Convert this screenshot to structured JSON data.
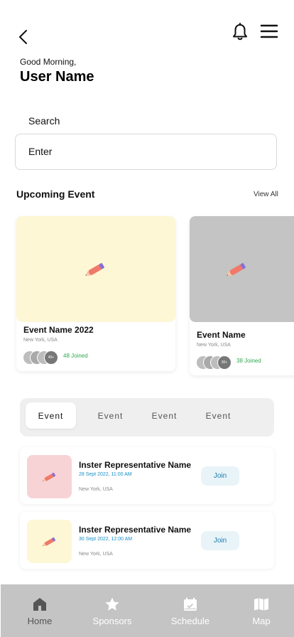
{
  "header": {
    "greeting": "Good Morning,",
    "user_name": "User Name"
  },
  "search": {
    "label": "Search",
    "placeholder": "Enter"
  },
  "upcoming": {
    "title": "Upcoming Event",
    "view_all": "View All",
    "cards": [
      {
        "name": "Event Name 2022",
        "location": "New York, USA",
        "count_badge": "40+",
        "joined": "48 Joined",
        "image_color": "#fef7d6"
      },
      {
        "name": "Event Name",
        "location": "New York, USA",
        "count_badge": "30+",
        "joined": "38 Joined",
        "image_color": "#c4c4c4"
      }
    ]
  },
  "tabs": [
    "Event",
    "Event",
    "Event",
    "Event"
  ],
  "list": [
    {
      "title": "Inster Representative Name",
      "date": "28 Sept 2022, 11:00 AM",
      "location": "New York, USA",
      "join_label": "Join",
      "thumb_color": "#f7d3d6"
    },
    {
      "title": "Inster Representative Name",
      "date": "30 Sept 2022, 12:00 AM",
      "location": "New York, USA",
      "join_label": "Join",
      "thumb_color": "#fef7d6"
    }
  ],
  "bottom_nav": [
    {
      "label": "Home",
      "icon": "home-icon"
    },
    {
      "label": "Sponsors",
      "icon": "star-icon"
    },
    {
      "label": "Schedule",
      "icon": "calendar-icon"
    },
    {
      "label": "Map",
      "icon": "map-icon"
    }
  ]
}
